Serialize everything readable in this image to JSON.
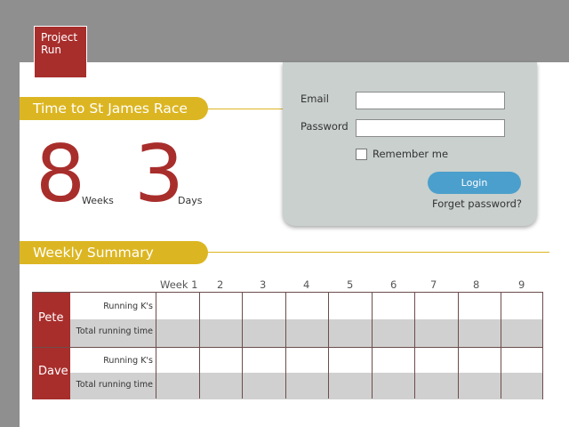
{
  "logo": {
    "line1": "Project",
    "line2": "Run"
  },
  "countdown": {
    "title": "Time to St James Race",
    "weeks_value": "8",
    "weeks_label": "Weeks",
    "days_value": "3",
    "days_label": "Days"
  },
  "login": {
    "email_label": "Email",
    "email_value": "",
    "password_label": "Password",
    "password_value": "",
    "remember_label": "Remember me",
    "login_button": "Login",
    "forgot_link": "Forget password?"
  },
  "summary": {
    "title": "Weekly Summary",
    "weeks": [
      "Week 1",
      "2",
      "3",
      "4",
      "5",
      "6",
      "7",
      "8",
      "9"
    ],
    "runners": [
      {
        "name": "Pete",
        "rows": [
          "Running K's",
          "Total running time"
        ]
      },
      {
        "name": "Dave",
        "rows": [
          "Running K's",
          "Total running time"
        ]
      }
    ]
  },
  "colors": {
    "brand_red": "#a82e2c",
    "accent_gold": "#dcb622",
    "login_blue": "#4b9fcc",
    "panel_grey": "#c9d0cd"
  }
}
